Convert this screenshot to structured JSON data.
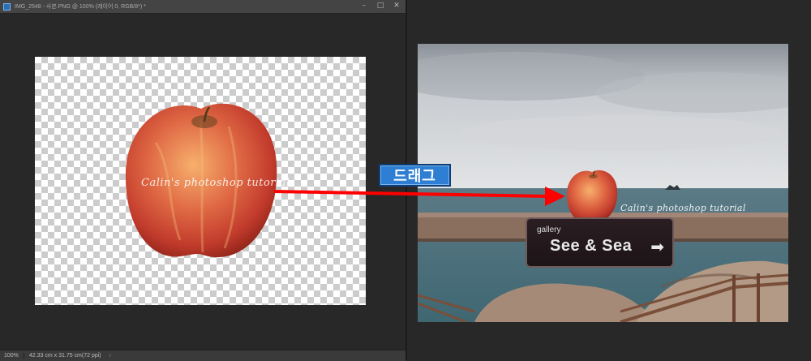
{
  "left_window": {
    "title": "IMG_2548 - 사본.PNG @ 100% (레이어 0, RGB/8*) *",
    "controls": {
      "minimize": "–",
      "maximize": "□",
      "close": "✕"
    },
    "status": {
      "zoom": "100%",
      "dimensions": "42.33 cm x 31.75 cm(72 ppi)",
      "arrow": "›"
    }
  },
  "right_window": {
    "sign_small": "gallery",
    "sign_big": "See & Sea",
    "sign_arrow": "➡"
  },
  "watermark": "Calin's photoshop tutorial",
  "drag_label": "드래그",
  "colors": {
    "arrow": "#ff0000",
    "drag_label_bg": "#2e7fd3",
    "workspace": "#282828"
  }
}
